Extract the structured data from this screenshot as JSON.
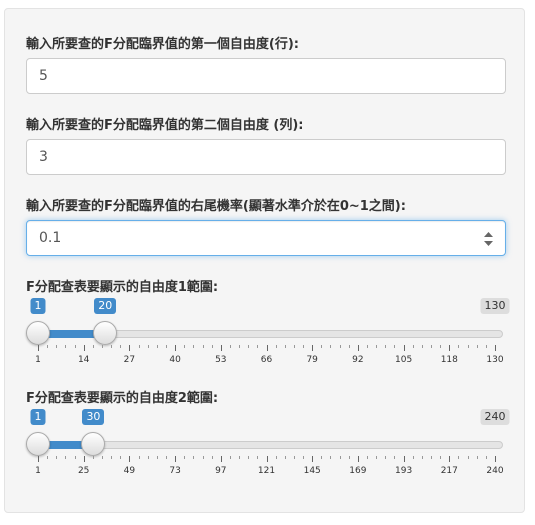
{
  "fields": {
    "df1": {
      "label": "輸入所要查的F分配臨界值的第一個自由度(行):",
      "value": "5"
    },
    "df2": {
      "label": "輸入所要查的F分配臨界值的第二個自由度 (列):",
      "value": "3"
    },
    "tail": {
      "label": "輸入所要查的F分配臨界值的右尾機率(顯著水準介於在0~1之間):",
      "value": "0.1"
    }
  },
  "slider1": {
    "label": "F分配查表要顯示的自由度1範圍:",
    "min": 1,
    "max": 130,
    "from": 1,
    "to": 20,
    "from_label": "1",
    "to_label": "20",
    "max_label": "130",
    "ticks": [
      "1",
      "14",
      "27",
      "40",
      "53",
      "66",
      "79",
      "92",
      "105",
      "118",
      "130"
    ]
  },
  "slider2": {
    "label": "F分配查表要顯示的自由度2範圍:",
    "min": 1,
    "max": 240,
    "from": 1,
    "to": 30,
    "from_label": "1",
    "to_label": "30",
    "max_label": "240",
    "ticks": [
      "1",
      "25",
      "49",
      "73",
      "97",
      "121",
      "145",
      "169",
      "193",
      "217",
      "240"
    ]
  },
  "colors": {
    "accent": "#428bca",
    "panel": "#f5f5f5",
    "focus": "#66afe9"
  }
}
